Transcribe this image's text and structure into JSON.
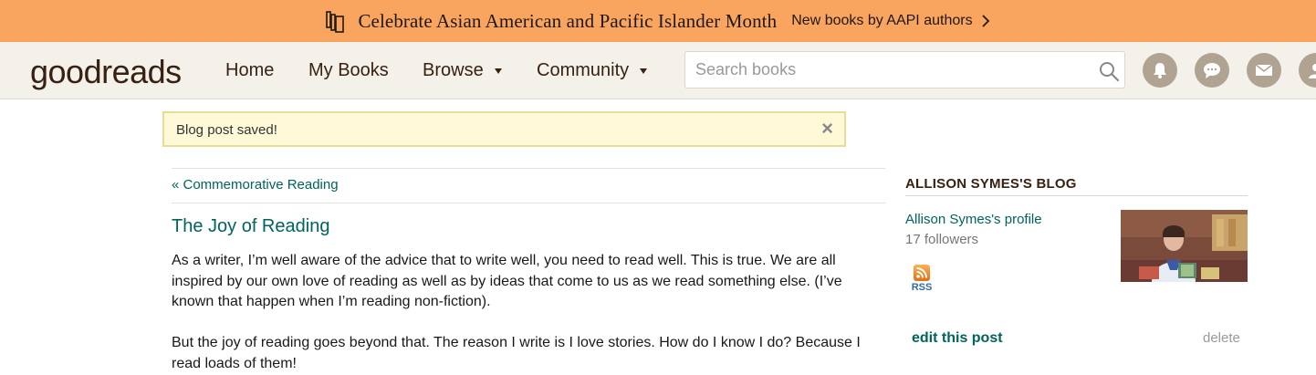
{
  "banner": {
    "title": "Celebrate Asian American and Pacific Islander Month",
    "link_label": "New books by AAPI authors",
    "background_color": "#f9a45f"
  },
  "header": {
    "logo_part1": "good",
    "logo_part2": "reads",
    "nav": {
      "home": "Home",
      "my_books": "My Books",
      "browse": "Browse",
      "community": "Community"
    },
    "search": {
      "placeholder": "Search books"
    },
    "icons": [
      "notifications-icon",
      "chat-icon",
      "mail-icon",
      "avatar"
    ]
  },
  "alert": {
    "text": "Blog post saved!",
    "close_label": "×"
  },
  "post": {
    "prev_link": "« Commemorative Reading",
    "title": "The Joy of Reading",
    "paragraphs": [
      "As a writer, I’m well aware of the advice that to write well, you need to read well. This is true. We are all inspired by our own love of reading as well as by ideas that come to us as we read something else. (I’ve known that happen when I’m reading non-fiction).",
      "But the joy of reading goes beyond that. The reason I write is I love stories. How do I know I do? Because I read loads of them!"
    ]
  },
  "sidebar": {
    "title": "ALLISON SYMES'S BLOG",
    "profile_link": "Allison Symes's profile",
    "followers": "17 followers",
    "rss_label": "RSS",
    "edit_link": "edit this post",
    "delete_link": "delete"
  },
  "colors": {
    "link": "#00635d",
    "header_bg": "#f4f1ea",
    "brand_brown": "#382110",
    "alert_bg": "#fff9d8"
  }
}
